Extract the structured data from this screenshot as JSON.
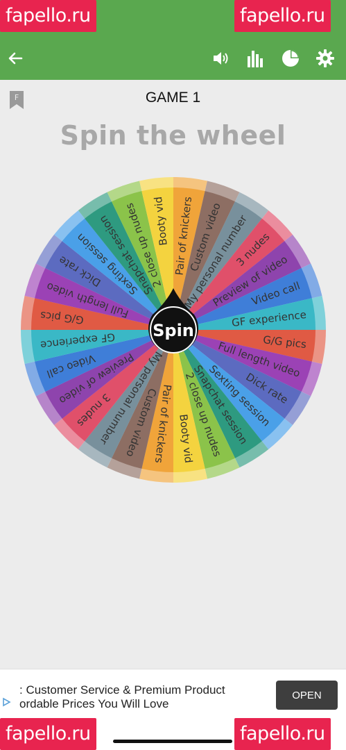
{
  "watermarks": {
    "left": "fapello.ru",
    "right": "fapello.ru",
    "bottom_left": "fapello.ru",
    "bottom_right": "fapello.ru"
  },
  "colors": {
    "appbar": "#5aa84f",
    "watermark": "#e8244f",
    "title": "#a8a8a8"
  },
  "appbar": {
    "icons": [
      "back-arrow-icon",
      "volume-icon",
      "bar-chart-icon",
      "pie-chart-icon",
      "gear-icon"
    ]
  },
  "game": {
    "label": "GAME 1",
    "title": "Spin the wheel",
    "bookmark_letter": "F"
  },
  "wheel": {
    "center_label": "Spin",
    "segments": [
      {
        "label": "Pair of knickers",
        "color": "#f0a43a"
      },
      {
        "label": "Custom video",
        "color": "#8d6e63"
      },
      {
        "label": "My personal number",
        "color": "#78909c"
      },
      {
        "label": "3 nudes",
        "color": "#e0506a"
      },
      {
        "label": "Preview of video",
        "color": "#8e44ad"
      },
      {
        "label": "Video call",
        "color": "#3f7ed8"
      },
      {
        "label": "GF experience",
        "color": "#3ab8c6"
      },
      {
        "label": "G/G pics",
        "color": "#e05a44"
      },
      {
        "label": "Full length video",
        "color": "#9b42b5"
      },
      {
        "label": "Dick rate",
        "color": "#5c6bc0"
      },
      {
        "label": "Sexting session",
        "color": "#4aa0e8"
      },
      {
        "label": "Snapchat session",
        "color": "#2e9a80"
      },
      {
        "label": "2 close up nudes",
        "color": "#8bc34a"
      },
      {
        "label": "Booty vid",
        "color": "#f4d33f"
      },
      {
        "label": "Pair of knickers",
        "color": "#f0a43a"
      },
      {
        "label": "Custom video",
        "color": "#8d6e63"
      },
      {
        "label": "My personal number",
        "color": "#78909c"
      },
      {
        "label": "3 nudes",
        "color": "#e0506a"
      },
      {
        "label": "Preview of video",
        "color": "#8e44ad"
      },
      {
        "label": "Video call",
        "color": "#3f7ed8"
      },
      {
        "label": "GF experience",
        "color": "#3ab8c6"
      },
      {
        "label": "G/G pics",
        "color": "#e05a44"
      },
      {
        "label": "Full length video",
        "color": "#9b42b5"
      },
      {
        "label": "Dick rate",
        "color": "#5c6bc0"
      },
      {
        "label": "Sexting session",
        "color": "#4aa0e8"
      },
      {
        "label": "Snapchat session",
        "color": "#2e9a80"
      },
      {
        "label": "2 close up nudes",
        "color": "#8bc34a"
      },
      {
        "label": "Booty vid",
        "color": "#f4d33f"
      }
    ]
  },
  "ad": {
    "line1": ": Customer Service & Premium Product",
    "line2": "ordable Prices You Will Love",
    "button": "OPEN"
  }
}
